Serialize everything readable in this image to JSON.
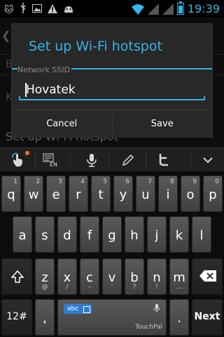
{
  "status_bar": {
    "notification_icons": [
      "cat-icon",
      "usb-icon",
      "image-icon",
      "warning-icon",
      "android-icon"
    ],
    "time": "19:39",
    "battery_level": 0.8,
    "accent": "#35b5e5"
  },
  "background": {
    "row1": "B",
    "row2": "K",
    "row3": "Set up Wi-Fi hotspot"
  },
  "dialog": {
    "title": "Set up Wi-Fi hotspot",
    "ssid_label": "Network SSID",
    "ssid_value": "Hovatek",
    "cancel_label": "Cancel",
    "save_label": "Save",
    "accent": "#33b5e5"
  },
  "toolbar": {
    "icons": [
      "touch-icon",
      "keyboard-en-icon",
      "microphone-icon",
      "pencil-icon",
      "twitter-icon",
      "chevron-down-icon"
    ],
    "lang_badge": "EN"
  },
  "keyboard": {
    "row1": [
      {
        "key": "q",
        "hint": "1"
      },
      {
        "key": "w",
        "hint": "2"
      },
      {
        "key": "e",
        "hint": "3"
      },
      {
        "key": "r",
        "hint": "4"
      },
      {
        "key": "t",
        "hint": "5"
      },
      {
        "key": "y",
        "hint": "6"
      },
      {
        "key": "u",
        "hint": "7"
      },
      {
        "key": "i",
        "hint": "8"
      },
      {
        "key": "o",
        "hint": "9"
      },
      {
        "key": "p",
        "hint": "0"
      }
    ],
    "row2": [
      "a",
      "s",
      "d",
      "f",
      "g",
      "h",
      "j",
      "k",
      "l"
    ],
    "row3": [
      {
        "key": "z",
        "sub": "@"
      },
      {
        "key": "x",
        "sub": "/"
      },
      {
        "key": "c",
        "sub": "-"
      },
      {
        "key": "v",
        "sub": "'"
      },
      {
        "key": "b",
        "sub": "?"
      },
      {
        "key": "n",
        "sub": "!"
      },
      {
        "key": "m",
        "sub": "..."
      }
    ],
    "symbols_label": "12#",
    "comma_label": ",",
    "period_label": ".",
    "lang_pill": "abc",
    "brand": "TouchPal",
    "next_label": "Next"
  }
}
